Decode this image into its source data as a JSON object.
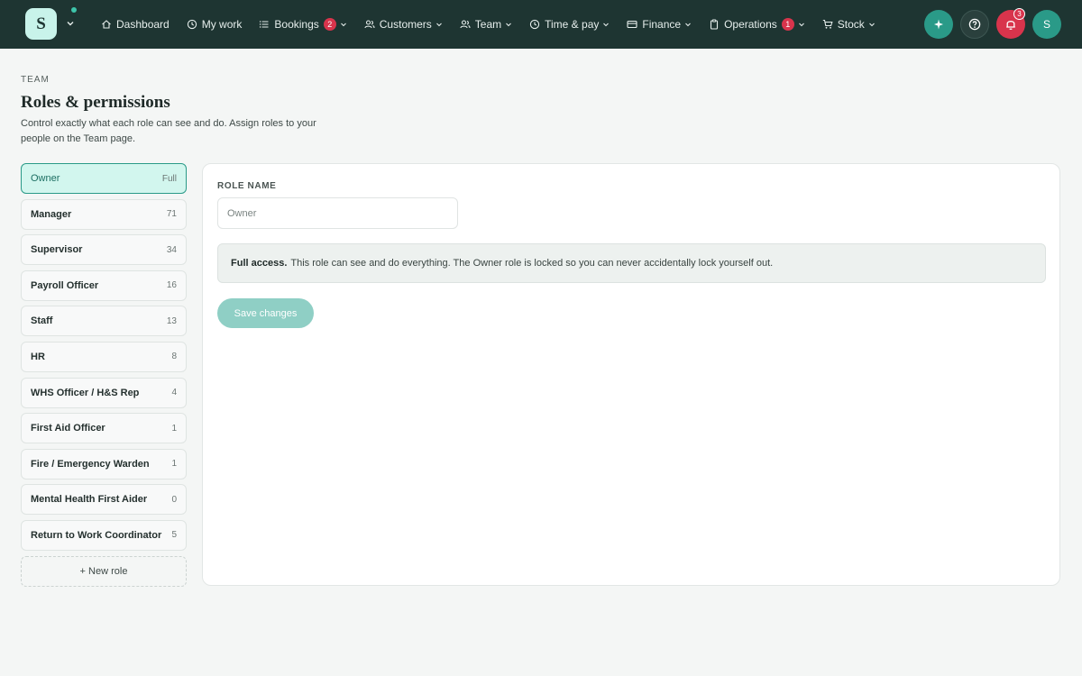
{
  "brand": {
    "letter": "S"
  },
  "nav": [
    {
      "label": "Dashboard",
      "icon": "home-icon",
      "chevron": false,
      "badge": ""
    },
    {
      "label": "My work",
      "icon": "clock-icon",
      "chevron": false,
      "badge": ""
    },
    {
      "label": "Bookings",
      "icon": "list-icon",
      "chevron": true,
      "badge": "2"
    },
    {
      "label": "Customers",
      "icon": "users-icon",
      "chevron": true,
      "badge": ""
    },
    {
      "label": "Team",
      "icon": "team-icon",
      "chevron": true,
      "badge": ""
    },
    {
      "label": "Time & pay",
      "icon": "clock-icon",
      "chevron": true,
      "badge": ""
    },
    {
      "label": "Finance",
      "icon": "card-icon",
      "chevron": true,
      "badge": ""
    },
    {
      "label": "Operations",
      "icon": "clipboard-icon",
      "chevron": true,
      "badge": "1"
    },
    {
      "label": "Stock",
      "icon": "cart-icon",
      "chevron": true,
      "badge": ""
    }
  ],
  "topbar": {
    "notifications_count": "3",
    "avatar_letter": "S"
  },
  "header": {
    "breadcrumb": "TEAM",
    "title": "Roles & permissions",
    "subtitle": "Control exactly what each role can see and do. Assign roles to your people on the Team page."
  },
  "roles": [
    {
      "name": "Owner",
      "count": "Full",
      "active": true
    },
    {
      "name": "Manager",
      "count": "71"
    },
    {
      "name": "Supervisor",
      "count": "34"
    },
    {
      "name": "Payroll Officer",
      "count": "16"
    },
    {
      "name": "Staff",
      "count": "13"
    },
    {
      "name": "HR",
      "count": "8"
    },
    {
      "name": "WHS Officer / H&S Rep",
      "count": "4"
    },
    {
      "name": "First Aid Officer",
      "count": "1"
    },
    {
      "name": "Fire / Emergency Warden",
      "count": "1"
    },
    {
      "name": "Mental Health First Aider",
      "count": "0"
    },
    {
      "name": "Return to Work Coordinator",
      "count": "5"
    }
  ],
  "new_role_label": "+ New role",
  "editor": {
    "field_label": "ROLE NAME",
    "role_name_value": "",
    "role_name_placeholder": "Owner",
    "notice_bold": "Full access.",
    "notice_text": "This role can see and do everything. The Owner role is locked so you can never accidentally lock yourself out.",
    "save_label": "Save changes"
  },
  "colors": {
    "topbar": "#1e3532",
    "accent": "#2a9a88",
    "danger": "#d8344c",
    "active_role_bg": "#d2f6ee"
  }
}
